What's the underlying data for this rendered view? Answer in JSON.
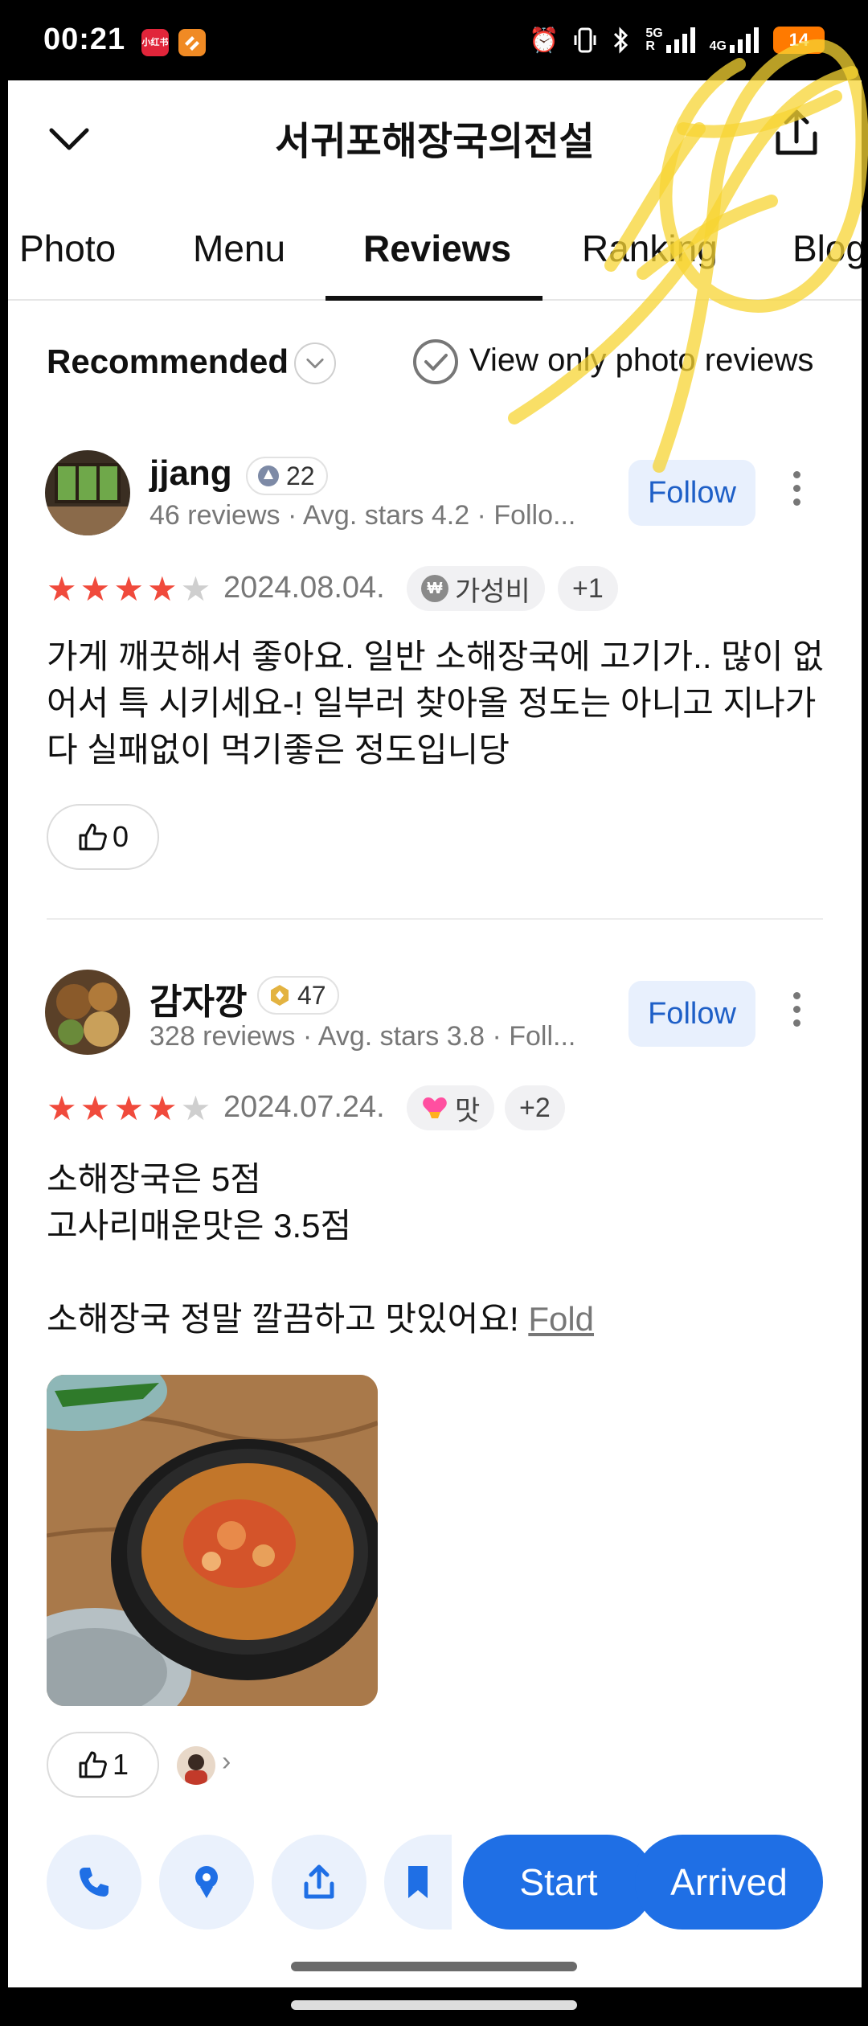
{
  "status_bar": {
    "time": "00:21",
    "app_icon_1": "小红书",
    "net_1": "5G",
    "net_1_sub": "R",
    "net_2": "4G",
    "battery": "14"
  },
  "header": {
    "title": "서귀포해장국의전설",
    "icons": [
      "chevron-down-icon",
      "share-icon"
    ]
  },
  "tabs": [
    {
      "label": "Photo",
      "active": false
    },
    {
      "label": "Menu",
      "active": false
    },
    {
      "label": "Reviews",
      "active": true
    },
    {
      "label": "Ranking",
      "active": false
    },
    {
      "label": "Blog",
      "active": false
    }
  ],
  "filter": {
    "sort_label": "Recommended",
    "photo_only_label": "View only photo reviews"
  },
  "reviews": [
    {
      "name": "jjang",
      "level": "22",
      "level_color": "#7d8aa6",
      "meta": "46 reviews · Avg. stars 4.2 · Follo...",
      "follow_label": "Follow",
      "rating": 4,
      "date": "2024.08.04.",
      "tag": "가성비",
      "tag_icon": "₩",
      "tag_extra": "+1",
      "body": "가게 깨끗해서 좋아요. 일반 소해장국에 고기가.. 많이 없어서 특 시키세요-! 일부러 찾아올 정도는 아니고 지나가다 실패없이 먹기좋은 정도입니당",
      "likes": "0"
    },
    {
      "name": "감자깡",
      "level": "47",
      "level_color": "#e3b341",
      "meta": "328 reviews · Avg. stars 3.8 · Foll...",
      "follow_label": "Follow",
      "rating": 4,
      "date": "2024.07.24.",
      "tag": "맛",
      "tag_extra": "+2",
      "body_lines": [
        "소해장국은 5점",
        "고사리매운맛은 3.5점",
        "",
        "소해장국 정말 깔끔하고 맛있어요!"
      ],
      "fold_label": "Fold",
      "likes": "1"
    }
  ],
  "action_bar": {
    "icons": [
      "phone-icon",
      "location-pin-icon",
      "share-icon",
      "bookmark-icon"
    ],
    "start_label": "Start",
    "arrived_label": "Arrived"
  },
  "colors": {
    "accent": "#1f6fe5",
    "follow_bg": "#e8f0fd",
    "star": "#f04a3c",
    "star_empty": "#cfcfcf"
  }
}
